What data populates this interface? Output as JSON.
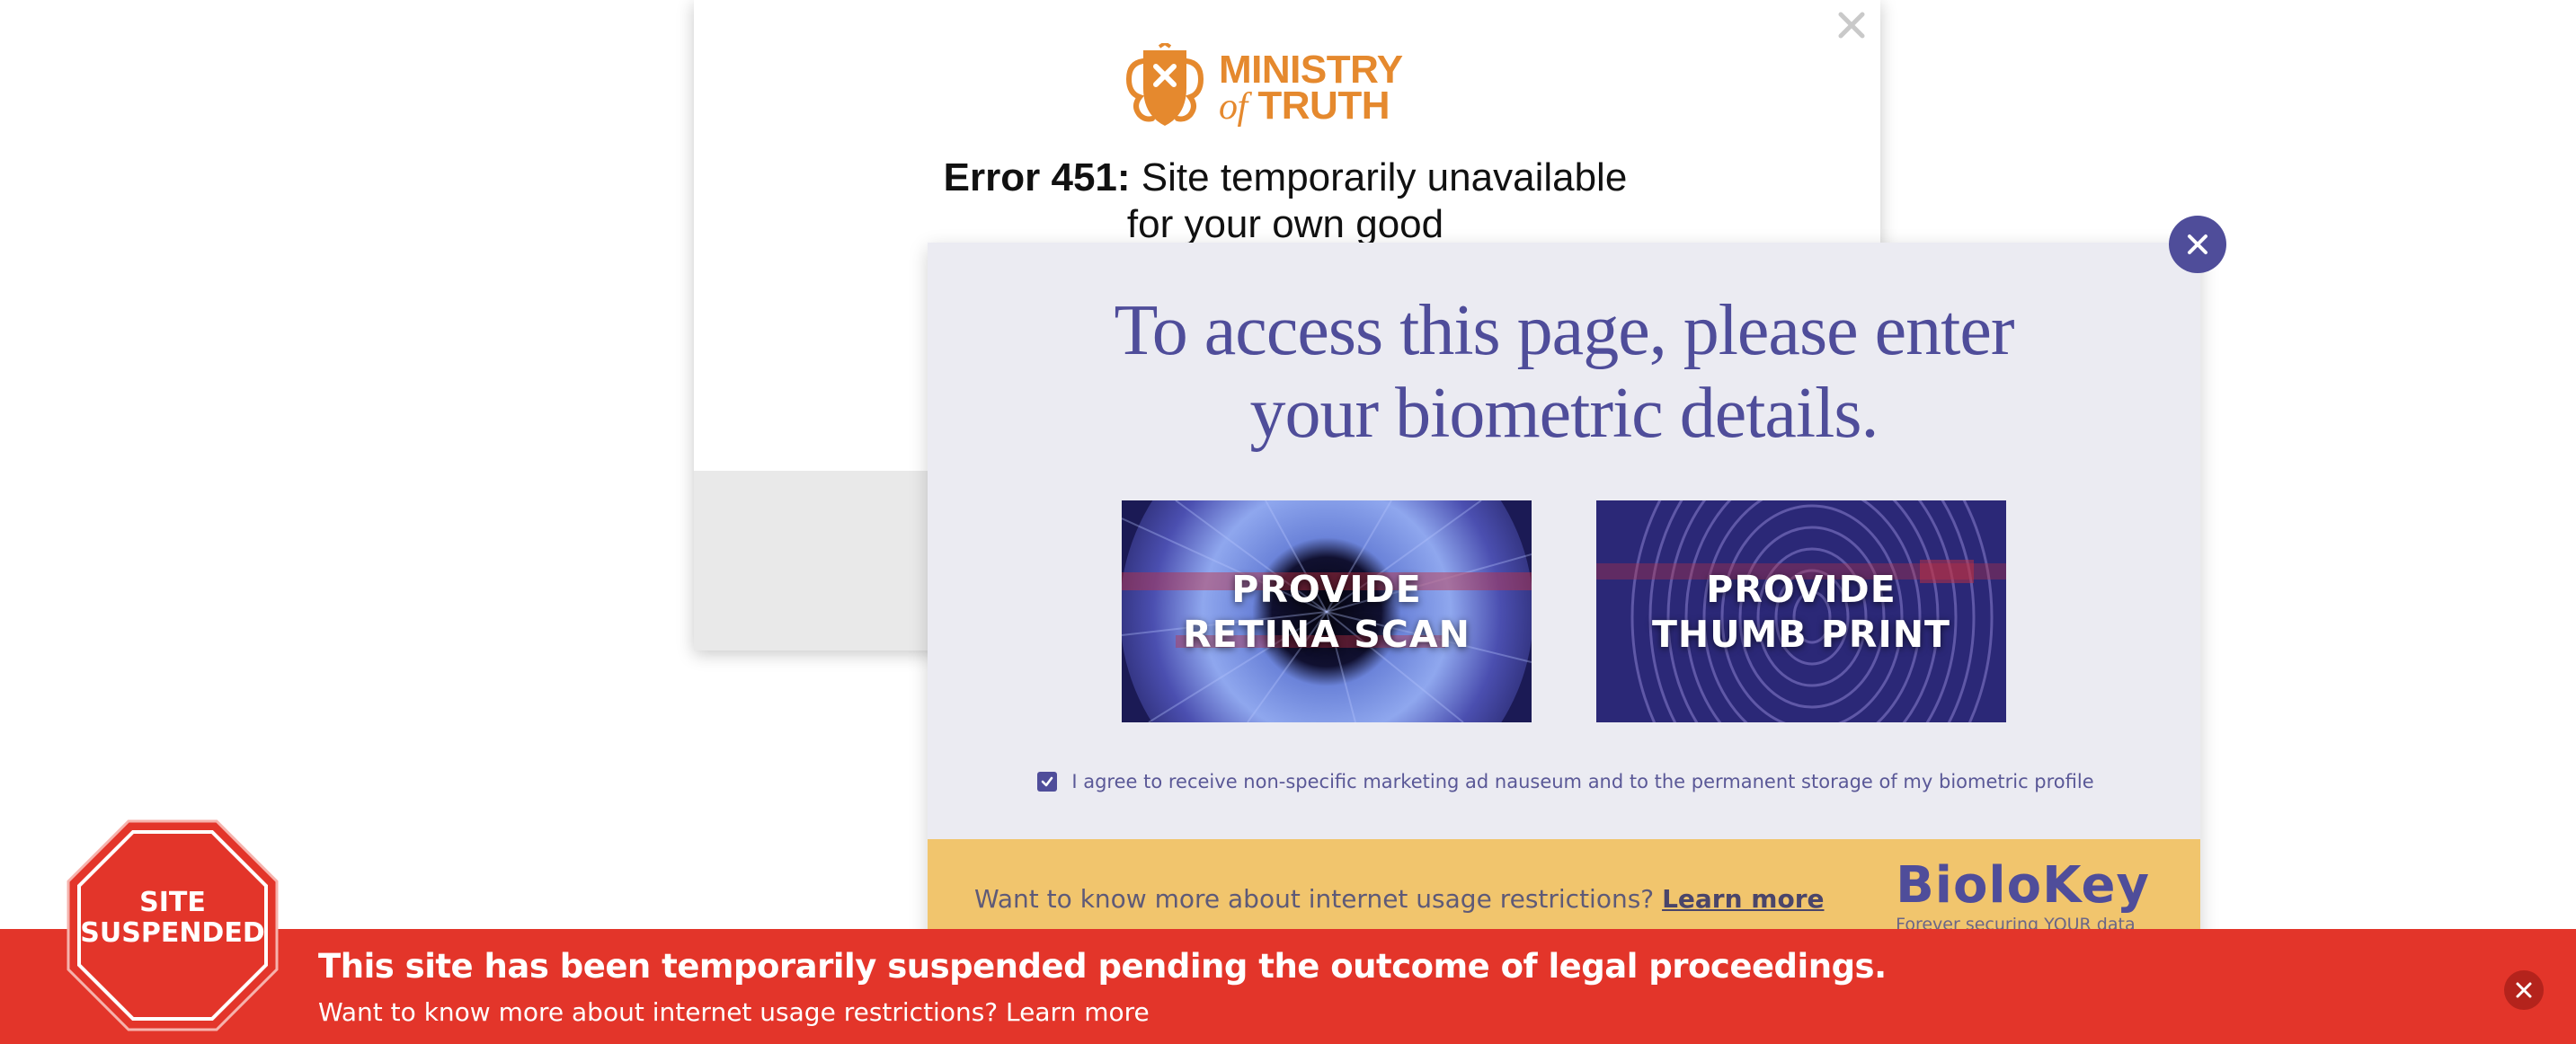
{
  "ministry_modal": {
    "logo_line1": "MINISTRY",
    "logo_of": "of",
    "logo_line2": "TRUTH",
    "error_code": "Error 451:",
    "error_message": "Site temporarily unavailable for your own good",
    "close_icon": "close-icon",
    "logo_icon": "crest-shield-icon"
  },
  "biometric_modal": {
    "heading_line1": "To access this page, please enter",
    "heading_line2": "your biometric details.",
    "retina_label": "PROVIDE\nRETINA SCAN",
    "thumb_label": "PROVIDE\nTHUMB PRINT",
    "consent_checked": true,
    "consent_text": "I agree to receive non-specific marketing ad nauseum and to the permanent storage of my biometric profile",
    "footer_text": "Want to know more about internet usage restrictions?",
    "footer_link": "Learn more",
    "brand_name": "BioloKey",
    "brand_tagline": "Forever securing YOUR data",
    "close_icon": "close-icon"
  },
  "banner": {
    "stop_sign_text": "SITE\nSUSPENDED",
    "title": "This site has been temporarily suspended pending the outcome of legal proceedings.",
    "subtitle": "Want to know more about internet usage restrictions? Learn more",
    "close_icon": "close-icon"
  },
  "colors": {
    "ministry_orange": "#e5892e",
    "biolokey_purple": "#4f4d9a",
    "biolokey_footer": "#f1c56d",
    "banner_red": "#e3352a"
  }
}
